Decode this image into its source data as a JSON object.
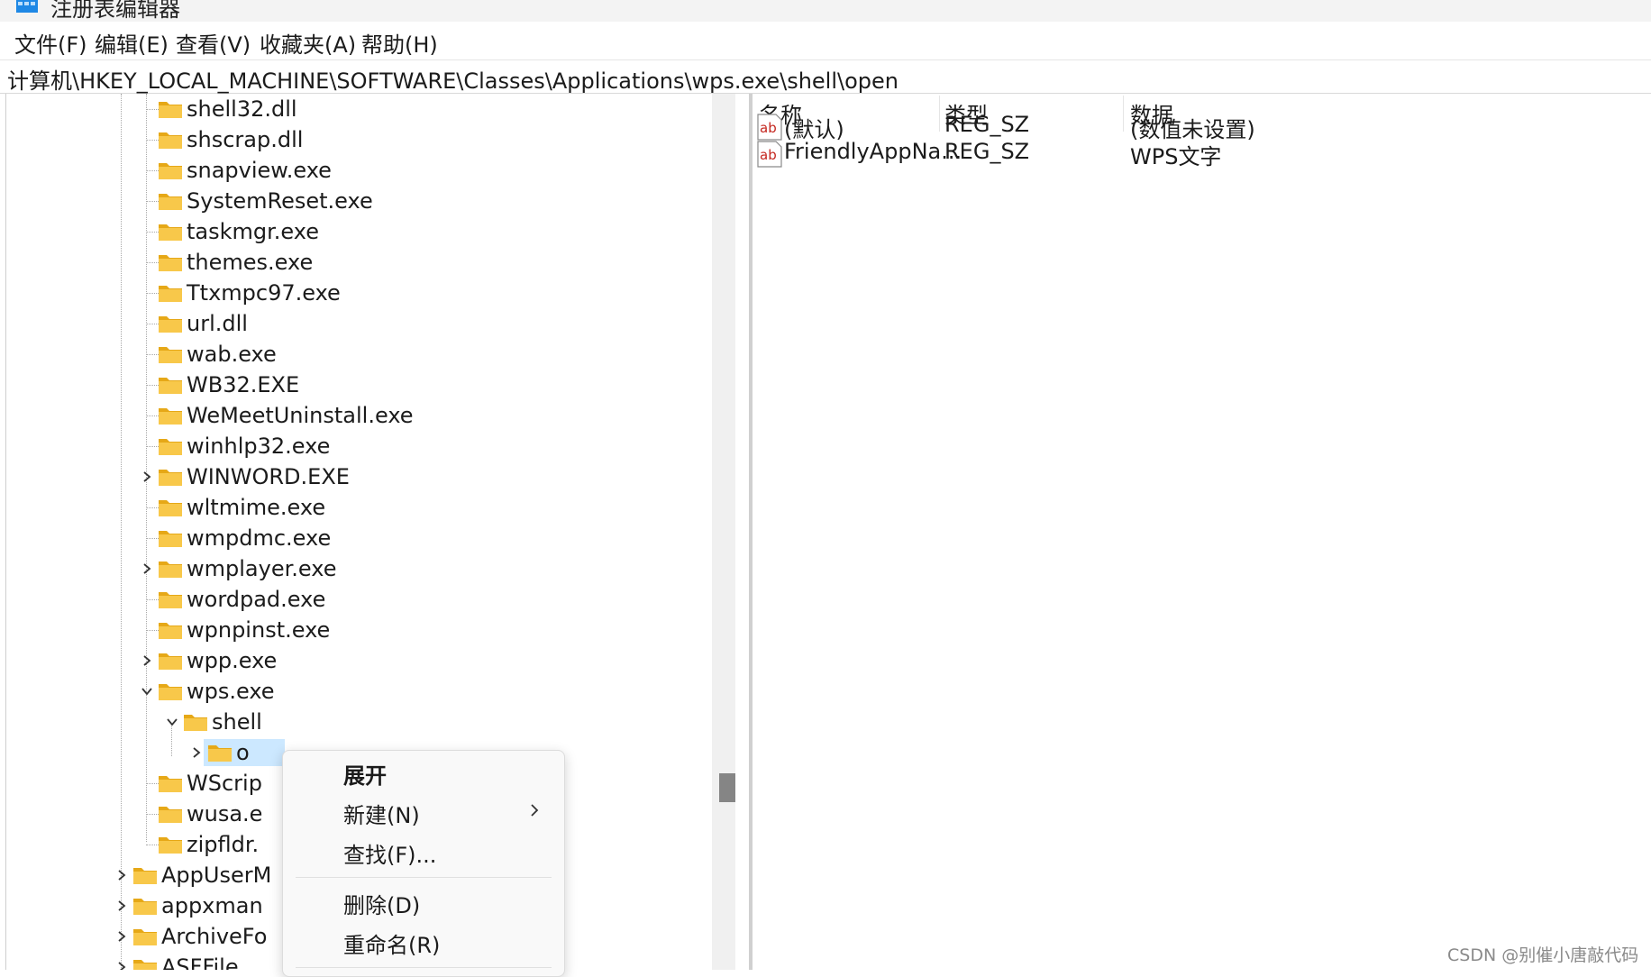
{
  "window": {
    "title": "注册表编辑器"
  },
  "menu": [
    "文件(F)",
    "编辑(E)",
    "查看(V)",
    "收藏夹(A)",
    "帮助(H)"
  ],
  "address": "计算机\\HKEY_LOCAL_MACHINE\\SOFTWARE\\Classes\\Applications\\wps.exe\\shell\\open",
  "tree": {
    "items": [
      {
        "label": "shell32.dll",
        "expander": "none"
      },
      {
        "label": "shscrap.dll",
        "expander": "none"
      },
      {
        "label": "snapview.exe",
        "expander": "none"
      },
      {
        "label": "SystemReset.exe",
        "expander": "none"
      },
      {
        "label": "taskmgr.exe",
        "expander": "none"
      },
      {
        "label": "themes.exe",
        "expander": "none"
      },
      {
        "label": "Ttxmpc97.exe",
        "expander": "none"
      },
      {
        "label": "url.dll",
        "expander": "none"
      },
      {
        "label": "wab.exe",
        "expander": "none"
      },
      {
        "label": "WB32.EXE",
        "expander": "none"
      },
      {
        "label": "WeMeetUninstall.exe",
        "expander": "none"
      },
      {
        "label": "winhlp32.exe",
        "expander": "none"
      },
      {
        "label": "WINWORD.EXE",
        "expander": "collapsed"
      },
      {
        "label": "wltmime.exe",
        "expander": "none"
      },
      {
        "label": "wmpdmc.exe",
        "expander": "none"
      },
      {
        "label": "wmplayer.exe",
        "expander": "collapsed"
      },
      {
        "label": "wordpad.exe",
        "expander": "none"
      },
      {
        "label": "wpnpinst.exe",
        "expander": "none"
      },
      {
        "label": "wpp.exe",
        "expander": "collapsed"
      },
      {
        "label": "wps.exe",
        "expander": "expanded"
      },
      {
        "label": "shell",
        "expander": "expanded"
      },
      {
        "label": "o",
        "expander": "collapsed",
        "selected": true
      },
      {
        "label": "WScrip",
        "expander": "none"
      },
      {
        "label": "wusa.e",
        "expander": "none"
      },
      {
        "label": "zipfldr.",
        "expander": "none"
      },
      {
        "label": "AppUserM",
        "expander": "collapsed"
      },
      {
        "label": "appxman",
        "expander": "collapsed"
      },
      {
        "label": "ArchiveFo",
        "expander": "collapsed"
      },
      {
        "label": "ASFFile",
        "expander": "collapsed"
      }
    ]
  },
  "values": {
    "headers": {
      "name": "名称",
      "type": "类型",
      "data": "数据"
    },
    "rows": [
      {
        "icon": "string-value-icon",
        "name": "(默认)",
        "type": "REG_SZ",
        "data": "(数值未设置)"
      },
      {
        "icon": "string-value-icon",
        "name": "FriendlyAppNa...",
        "type": "REG_SZ",
        "data": "WPS文字"
      }
    ]
  },
  "context_menu": {
    "items": [
      "展开",
      "新建(N)",
      "查找(F)...",
      "删除(D)",
      "重命名(R)"
    ]
  },
  "watermark": "CSDN @别催小唐敲代码",
  "colors": {
    "selection": "#cce8ff",
    "folder": "#f8c84a",
    "ab_icon": "#c4271f"
  }
}
